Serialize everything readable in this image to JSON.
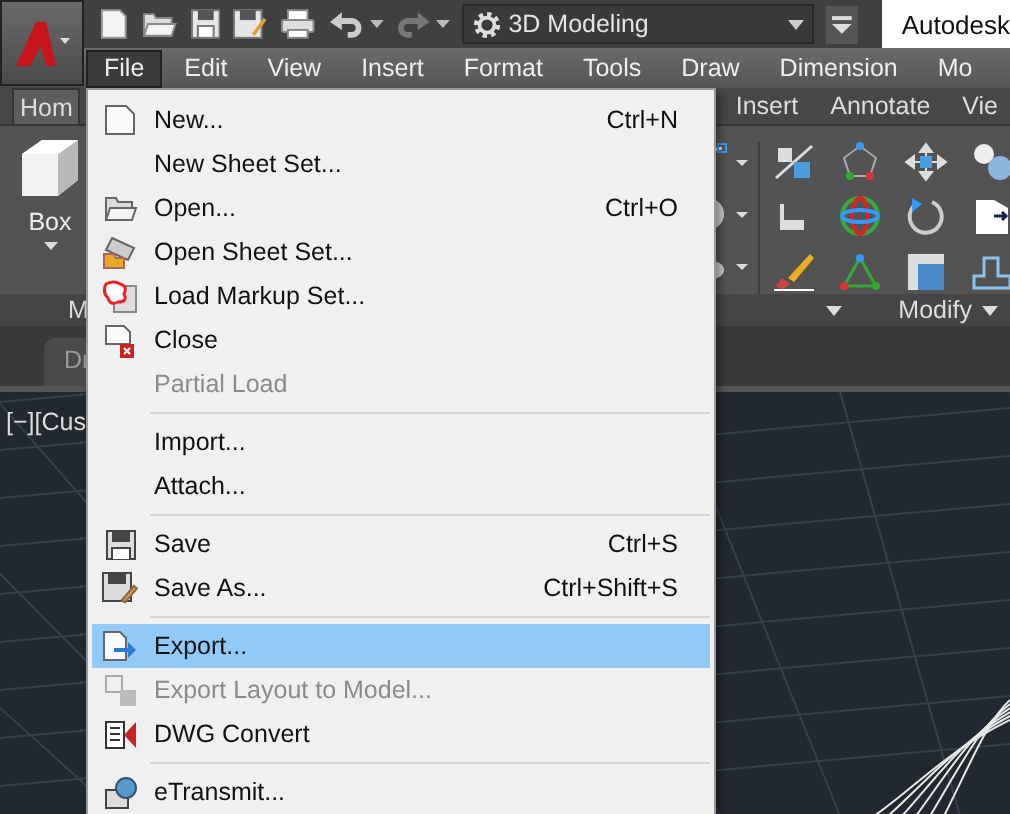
{
  "quick_access": {
    "workspace": "3D Modeling",
    "title": "Autodesk"
  },
  "menu_bar": [
    {
      "label": "File",
      "selected": true
    },
    {
      "label": "Edit",
      "selected": false
    },
    {
      "label": "View",
      "selected": false
    },
    {
      "label": "Insert",
      "selected": false
    },
    {
      "label": "Format",
      "selected": false
    },
    {
      "label": "Tools",
      "selected": false
    },
    {
      "label": "Draw",
      "selected": false
    },
    {
      "label": "Dimension",
      "selected": false
    },
    {
      "label": "Mo",
      "selected": false
    }
  ],
  "ribbon_tabs": [
    {
      "label": "Hom",
      "selected": true
    },
    {
      "label": "Insert",
      "selected": false
    },
    {
      "label": "Annotate",
      "selected": false
    },
    {
      "label": "Vie",
      "selected": false
    }
  ],
  "ribbon": {
    "box_label": "Box",
    "panel_label": "M",
    "modify_label": "Modify"
  },
  "drawing_tab": "Dr",
  "viewport_label": "[−][Cus",
  "file_menu": [
    {
      "kind": "item",
      "label": "New...",
      "shortcut": "Ctrl+N",
      "disabled": false,
      "selected": false
    },
    {
      "kind": "item",
      "label": "New Sheet Set...",
      "disabled": false,
      "selected": false
    },
    {
      "kind": "item",
      "label": "Open...",
      "shortcut": "Ctrl+O",
      "disabled": false,
      "selected": false
    },
    {
      "kind": "item",
      "label": "Open Sheet Set...",
      "disabled": false,
      "selected": false
    },
    {
      "kind": "item",
      "label": "Load Markup Set...",
      "disabled": false,
      "selected": false
    },
    {
      "kind": "item",
      "label": "Close",
      "disabled": false,
      "selected": false
    },
    {
      "kind": "item",
      "label": "Partial Load",
      "disabled": true,
      "selected": false
    },
    {
      "kind": "separator"
    },
    {
      "kind": "item",
      "label": "Import...",
      "disabled": false,
      "selected": false
    },
    {
      "kind": "item",
      "label": "Attach...",
      "disabled": false,
      "selected": false
    },
    {
      "kind": "separator"
    },
    {
      "kind": "item",
      "label": "Save",
      "shortcut": "Ctrl+S",
      "disabled": false,
      "selected": false
    },
    {
      "kind": "item",
      "label": "Save As...",
      "shortcut": "Ctrl+Shift+S",
      "disabled": false,
      "selected": false
    },
    {
      "kind": "separator"
    },
    {
      "kind": "item",
      "label": "Export...",
      "disabled": false,
      "selected": true
    },
    {
      "kind": "item",
      "label": "Export Layout to Model...",
      "disabled": true,
      "selected": false
    },
    {
      "kind": "item",
      "label": "DWG Convert",
      "disabled": false,
      "selected": false
    },
    {
      "kind": "separator"
    },
    {
      "kind": "item",
      "label": "eTransmit...",
      "disabled": false,
      "selected": false
    }
  ]
}
